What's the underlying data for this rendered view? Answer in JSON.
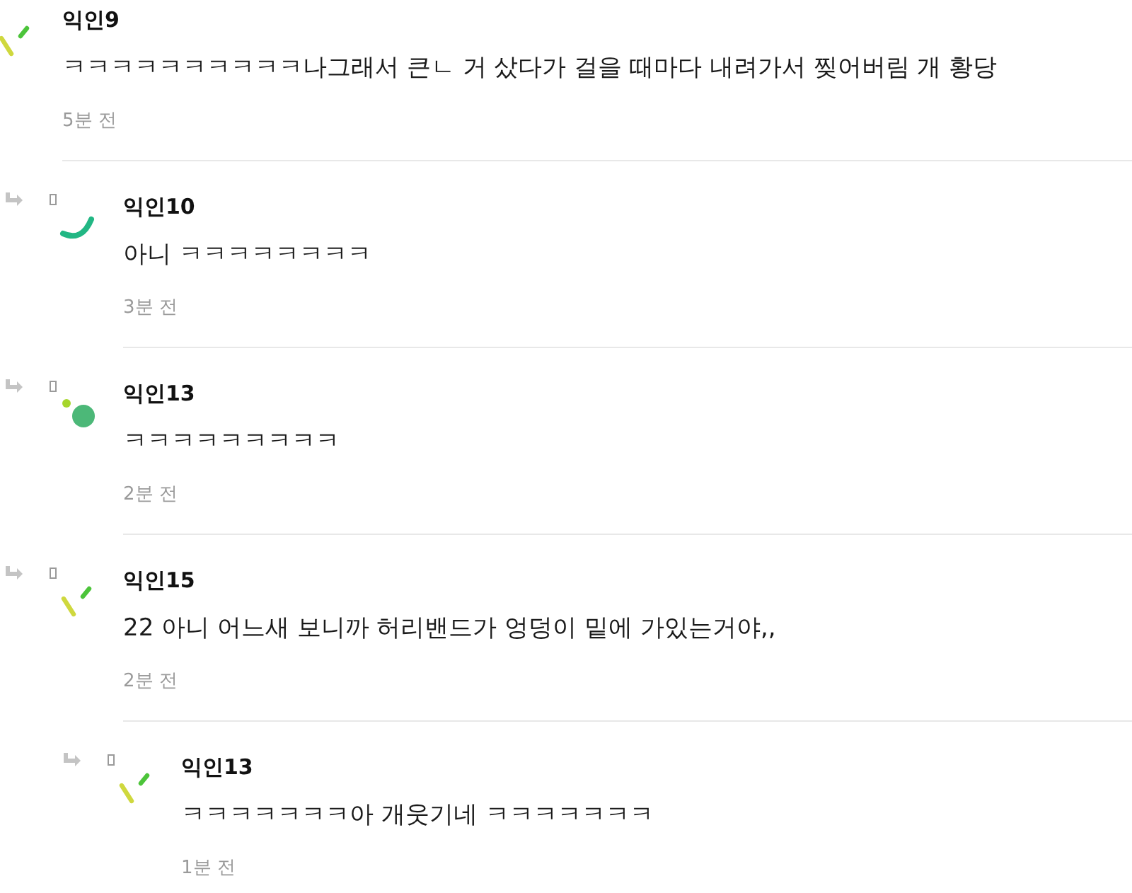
{
  "comments": [
    {
      "author": "익인9",
      "body": "ㅋㅋㅋㅋㅋㅋㅋㅋㅋㅋ나그래서 큰ㄴ 거 샀다가 걸을 때마다 내려가서 찢어버림 개 황당",
      "time": "5분 전",
      "avatar": {
        "kind": "dashes"
      },
      "children": [
        {
          "author": "익인10",
          "body": "아니 ㅋㅋㅋㅋㅋㅋㅋㅋ",
          "time": "3분 전",
          "avatar": {
            "kind": "arc"
          }
        },
        {
          "author": "익인13",
          "body": "ㅋㅋㅋㅋㅋㅋㅋㅋㅋ",
          "time": "2분 전",
          "avatar": {
            "kind": "dots"
          }
        },
        {
          "author": "익인15",
          "body": "22 아니 어느새 보니까 허리밴드가 엉덩이 밑에 가있는거야,,",
          "time": "2분 전",
          "avatar": {
            "kind": "dashes"
          },
          "children": [
            {
              "author": "익인13",
              "body": "ㅋㅋㅋㅋㅋㅋㅋ아 개웃기네 ㅋㅋㅋㅋㅋㅋㅋ",
              "time": "1분 전",
              "avatar": {
                "kind": "dashes"
              }
            }
          ]
        }
      ]
    }
  ]
}
